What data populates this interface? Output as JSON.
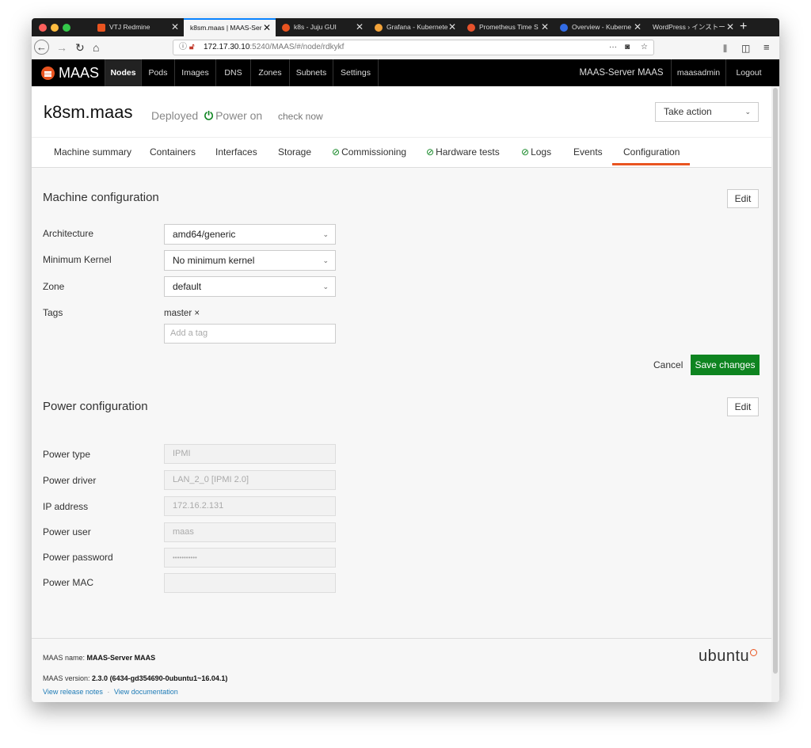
{
  "browser": {
    "tabs": [
      {
        "label": "VTJ Redmine",
        "favicon": "rocket-icon",
        "color": "#e95420"
      },
      {
        "label": "k8sm.maas | MAAS-Ser",
        "favicon": "",
        "color": "#ffffff"
      },
      {
        "label": "k8s - Juju GUI",
        "favicon": "juju-icon",
        "color": "#e95420"
      },
      {
        "label": "Grafana - Kubernete",
        "favicon": "grafana-icon",
        "color": "#f2a33a"
      },
      {
        "label": "Prometheus Time S",
        "favicon": "prometheus-icon",
        "color": "#e6522c"
      },
      {
        "label": "Overview - Kuberne",
        "favicon": "kubernetes-icon",
        "color": "#326ce5"
      },
      {
        "label": "WordPress › インストー",
        "favicon": "",
        "color": "#21759b"
      }
    ],
    "url_host": "172.17.30.10",
    "url_rest": ":5240/MAAS/#/node/rdkykf",
    "url_actions": "···"
  },
  "maas": {
    "brand": "MAAS",
    "nav": [
      "Nodes",
      "Pods",
      "Images",
      "DNS",
      "Zones",
      "Subnets",
      "Settings"
    ],
    "server_name": "MAAS-Server MAAS",
    "user": "maasadmin",
    "logout": "Logout"
  },
  "node": {
    "hostname": "k8sm.maas",
    "status": "Deployed",
    "power": "Power on",
    "check_now": "check now",
    "take_action": "Take action"
  },
  "tabs": {
    "items": [
      "Machine summary",
      "Containers",
      "Interfaces",
      "Storage",
      "Commissioning",
      "Hardware tests",
      "Logs",
      "Events",
      "Configuration"
    ],
    "active": "Configuration"
  },
  "machine_config": {
    "title": "Machine configuration",
    "edit": "Edit",
    "architecture_label": "Architecture",
    "architecture_value": "amd64/generic",
    "min_kernel_label": "Minimum Kernel",
    "min_kernel_value": "No minimum kernel",
    "zone_label": "Zone",
    "zone_value": "default",
    "tags_label": "Tags",
    "tag": "master ×",
    "tag_placeholder": "Add a tag",
    "cancel": "Cancel",
    "save": "Save changes"
  },
  "power_config": {
    "title": "Power configuration",
    "edit": "Edit",
    "fields": [
      {
        "label": "Power type",
        "value": "IPMI"
      },
      {
        "label": "Power driver",
        "value": "LAN_2_0 [IPMI 2.0]"
      },
      {
        "label": "IP address",
        "value": "172.16.2.131"
      },
      {
        "label": "Power user",
        "value": "maas"
      },
      {
        "label": "Power password",
        "value": "•••••••••••"
      },
      {
        "label": "Power MAC",
        "value": ""
      }
    ]
  },
  "footer": {
    "name_label": "MAAS name:",
    "name_value": "MAAS-Server MAAS",
    "version_label": "MAAS version:",
    "version_value": "2.3.0 (6434-gd354690-0ubuntu1~16.04.1)",
    "release_notes": "View release notes",
    "separator": "·",
    "documentation": "View documentation",
    "logo_text": "ubuntu"
  },
  "colors": {
    "accent": "#e95420",
    "success": "#0e8420",
    "link": "#1e7bb6"
  }
}
